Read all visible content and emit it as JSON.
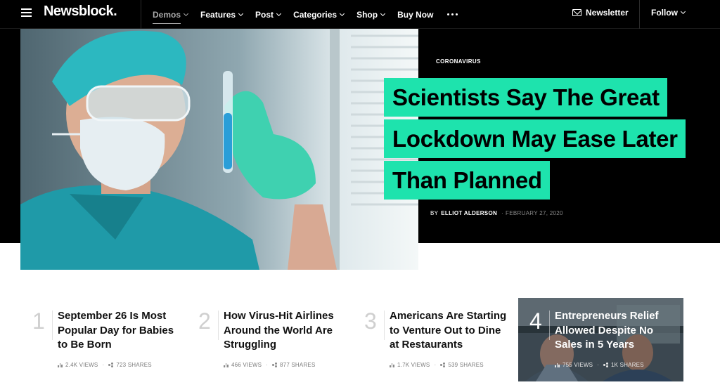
{
  "nav": {
    "logo": "Newsblock.",
    "menu": [
      {
        "label": "Demos",
        "has_dropdown": true,
        "active": true
      },
      {
        "label": "Features",
        "has_dropdown": true
      },
      {
        "label": "Post",
        "has_dropdown": true
      },
      {
        "label": "Categories",
        "has_dropdown": true
      },
      {
        "label": "Shop",
        "has_dropdown": true
      },
      {
        "label": "Buy Now",
        "has_dropdown": false
      }
    ],
    "more_icon": "ellipsis-icon",
    "newsletter_label": "Newsletter",
    "follow_label": "Follow"
  },
  "hero": {
    "category": "CORONAVIRUS",
    "title_lines": [
      "Scientists Say The Great",
      "Lockdown May Ease Later",
      "Than Planned"
    ],
    "byline_prefix": "BY",
    "author": "ELLIOT ALDERSON",
    "date_sep": "·",
    "date": "FEBRUARY 27, 2020",
    "image_icon": "scientist-test-tube-photo"
  },
  "articles": [
    {
      "num": "1",
      "title": "September 26 Is Most Popular Day for Babies to Be Born",
      "views": "2.4K VIEWS",
      "shares": "723 SHARES"
    },
    {
      "num": "2",
      "title": "How Virus-Hit Airlines Around the World Are Struggling",
      "views": "466 VIEWS",
      "shares": "877 SHARES"
    },
    {
      "num": "3",
      "title": "Americans Are Starting to Venture Out to Dine at Restaurants",
      "views": "1.7K VIEWS",
      "shares": "539 SHARES"
    },
    {
      "num": "4",
      "title": "Entrepreneurs Relief Allowed Despite No Sales in 5 Years",
      "views": "755 VIEWS",
      "shares": "1K SHARES"
    }
  ],
  "colors": {
    "accent": "#1ee3ad",
    "nav_bg": "#000000",
    "hero_bg": "#000000",
    "muted_number": "#cfcfcf"
  }
}
